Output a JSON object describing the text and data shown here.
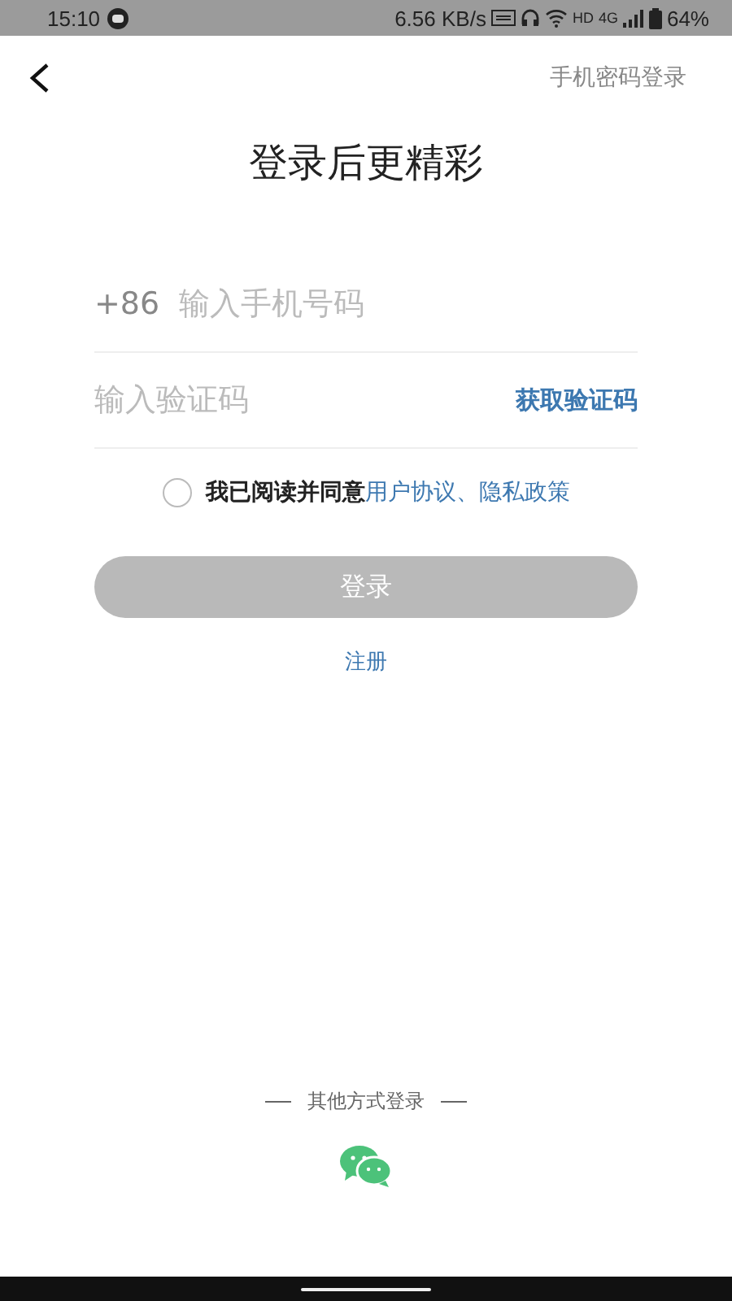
{
  "status_bar": {
    "time": "15:10",
    "speed": "6.56 KB/s",
    "hd": "HD",
    "network": "4G",
    "battery": "64%"
  },
  "header": {
    "action": "手机密码登录"
  },
  "title": "登录后更精彩",
  "phone": {
    "prefix": "+86",
    "placeholder": "输入手机号码"
  },
  "code": {
    "placeholder": "输入验证码",
    "action": "获取验证码"
  },
  "agreement": {
    "checked": false,
    "text": "我已阅读并同意",
    "links": [
      "用户协议",
      "隐私政策"
    ],
    "separator": "、"
  },
  "login_button": {
    "label": "登录",
    "disabled": true
  },
  "register": "注册",
  "other_login": {
    "label": "其他方式登录"
  }
}
